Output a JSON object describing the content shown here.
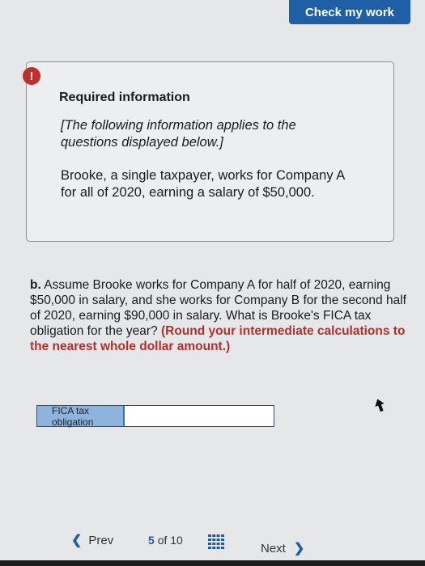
{
  "header": {
    "check_label": "Check my work"
  },
  "info_box": {
    "alert_symbol": "!",
    "title": "Required information",
    "italic_note": "[The following information applies to the questions displayed below.]",
    "body": "Brooke, a single taxpayer, works for Company A for all of 2020, earning a salary of $50,000."
  },
  "question": {
    "prefix": "b.",
    "text": " Assume Brooke works for Company A for half of 2020, earning $50,000 in salary, and she works for Company B for the second half of 2020, earning $90,000 in salary. What is Brooke's FICA tax obligation for the year? ",
    "hint": "(Round your intermediate calculations to the nearest whole dollar amount.)"
  },
  "answer": {
    "label": "FICA tax obligation",
    "value": ""
  },
  "footer": {
    "prev_label": "Prev",
    "prev_icon": "chevron-left-icon",
    "current_page": "5",
    "of_label": "of",
    "total_pages": "10",
    "grid_icon": "grid-icon",
    "next_label": "Next",
    "next_icon": "chevron-right-icon"
  },
  "colors": {
    "accent": "#1f5fa6",
    "hint": "#b0322d",
    "alert": "#c0302a",
    "label_bg": "#8eb4de"
  }
}
